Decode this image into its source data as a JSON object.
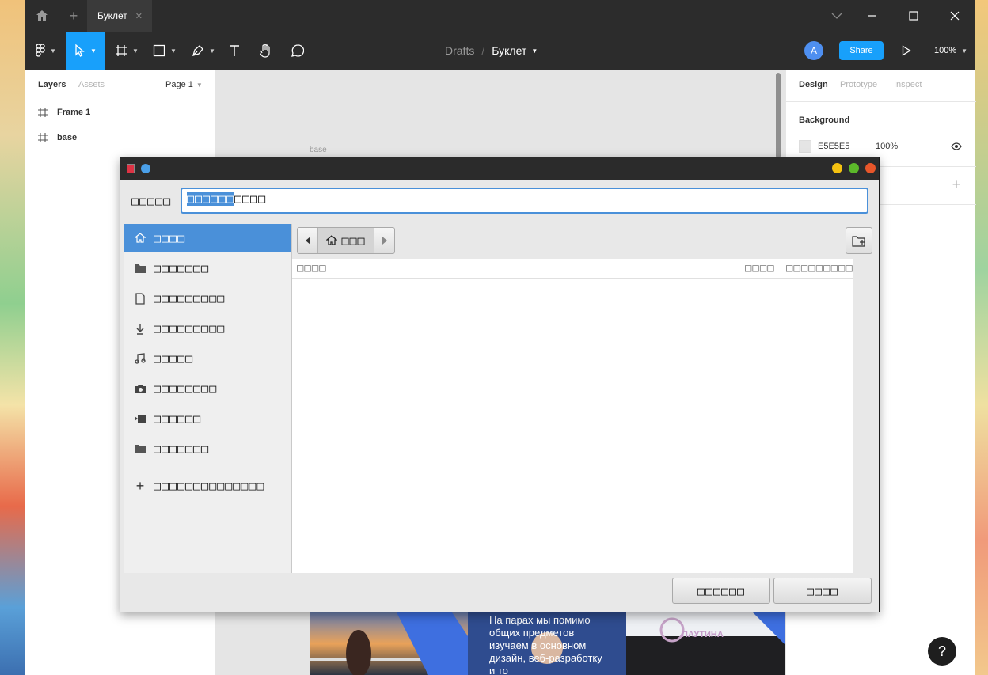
{
  "window": {
    "tab_title": "Буклет",
    "add_tab": "+",
    "tab_close": "✕"
  },
  "toolbar": {
    "breadcrumb_root": "Drafts",
    "breadcrumb_sep": "/",
    "file_name": "Буклет",
    "avatar_letter": "A",
    "share_label": "Share",
    "zoom": "100%"
  },
  "left_panel": {
    "tabs": [
      "Layers",
      "Assets"
    ],
    "page_selector": "Page 1",
    "layers": [
      {
        "name": "Frame 1"
      },
      {
        "name": "base"
      }
    ]
  },
  "canvas": {
    "frame_label": "base",
    "poster_text": "На парах мы помимо общих предметов изучаем в основном дизайн, веб-разработку и то",
    "poster_logo": "ПАУТИНА"
  },
  "right_panel": {
    "tabs": [
      "Design",
      "Prototype",
      "Inspect"
    ],
    "section_title": "Background",
    "bg_hex": "E5E5E5",
    "bg_opacity": "100%",
    "add_symbol": "+"
  },
  "dialog": {
    "name_label": "□□□□□",
    "name_value_selected": "□□□□□□",
    "name_value_rest": "□□□□",
    "location_button": "□□□",
    "columns": {
      "name": "□□□□",
      "size": "□□□□",
      "modified": "□□□□□□□□□"
    },
    "places": [
      {
        "icon": "home-icon",
        "label": "□□□□",
        "selected": true
      },
      {
        "icon": "folder-icon",
        "label": "□□□□□□□"
      },
      {
        "icon": "document-icon",
        "label": "□□□□□□□□□"
      },
      {
        "icon": "download-icon",
        "label": "□□□□□□□□□"
      },
      {
        "icon": "music-icon",
        "label": "□□□□□"
      },
      {
        "icon": "camera-icon",
        "label": "□□□□□□□□"
      },
      {
        "icon": "video-icon",
        "label": "□□□□□□"
      },
      {
        "icon": "folder-icon",
        "label": "□□□□□□□"
      }
    ],
    "other_locations": "□□□□□□□□□□□□□□",
    "cancel_label": "□□□□□□",
    "save_label": "□□□□",
    "colors": {
      "accent": "#4a90d9",
      "titlebar": "#2b2b2b"
    }
  },
  "help_button": "?",
  "colors": {
    "figma_dark": "#2c2c2c",
    "share_blue": "#18a0fb",
    "avatar": "#4e8ff0"
  }
}
